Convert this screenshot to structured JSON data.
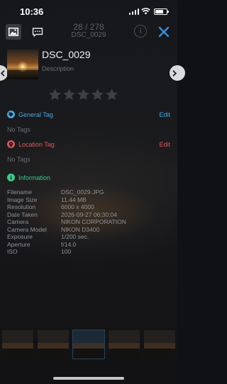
{
  "status": {
    "time": "10:36"
  },
  "toolbar": {
    "counter": "28 / 278",
    "subtitle": "DSC_0029",
    "info_label": "i"
  },
  "photo": {
    "title": "DSC_0029",
    "description_placeholder": "Description",
    "rating": 0,
    "max_rating": 5
  },
  "sections": {
    "general": {
      "title": "General Tag",
      "edit": "Edit",
      "empty": "No Tags",
      "color": "#4aa6e0"
    },
    "location": {
      "title": "Location Tag",
      "edit": "Edit",
      "empty": "No Tags",
      "color": "#e0565b"
    },
    "information": {
      "title": "Information",
      "color": "#3cc98a"
    }
  },
  "info": {
    "rows": [
      {
        "label": "Filename",
        "value": "DSC_0029.JPG"
      },
      {
        "label": "Image Size",
        "value": "11.44 MB"
      },
      {
        "label": "Resolution",
        "value": "6000 x 4000"
      },
      {
        "label": "Date Taken",
        "value": "2026-09-27 06:30:04"
      },
      {
        "label": "Camera",
        "value": "NIKON CORPORATION"
      },
      {
        "label": "Camera Model",
        "value": "NIKON D3400"
      },
      {
        "label": "Exposure",
        "value": "1/200 sec."
      },
      {
        "label": "Aperture",
        "value": "f/14.0"
      },
      {
        "label": "ISO",
        "value": "100"
      }
    ]
  },
  "colors": {
    "accent": "#4aa6e0",
    "close": "#3a8fd9",
    "star_empty": "#3e4044"
  },
  "icons": [
    "photo-icon",
    "chat-icon",
    "info-icon",
    "close-icon",
    "chevron-left-icon",
    "chevron-right-icon",
    "tag-icon",
    "location-pin-icon",
    "info-circle-icon",
    "star-icon"
  ]
}
